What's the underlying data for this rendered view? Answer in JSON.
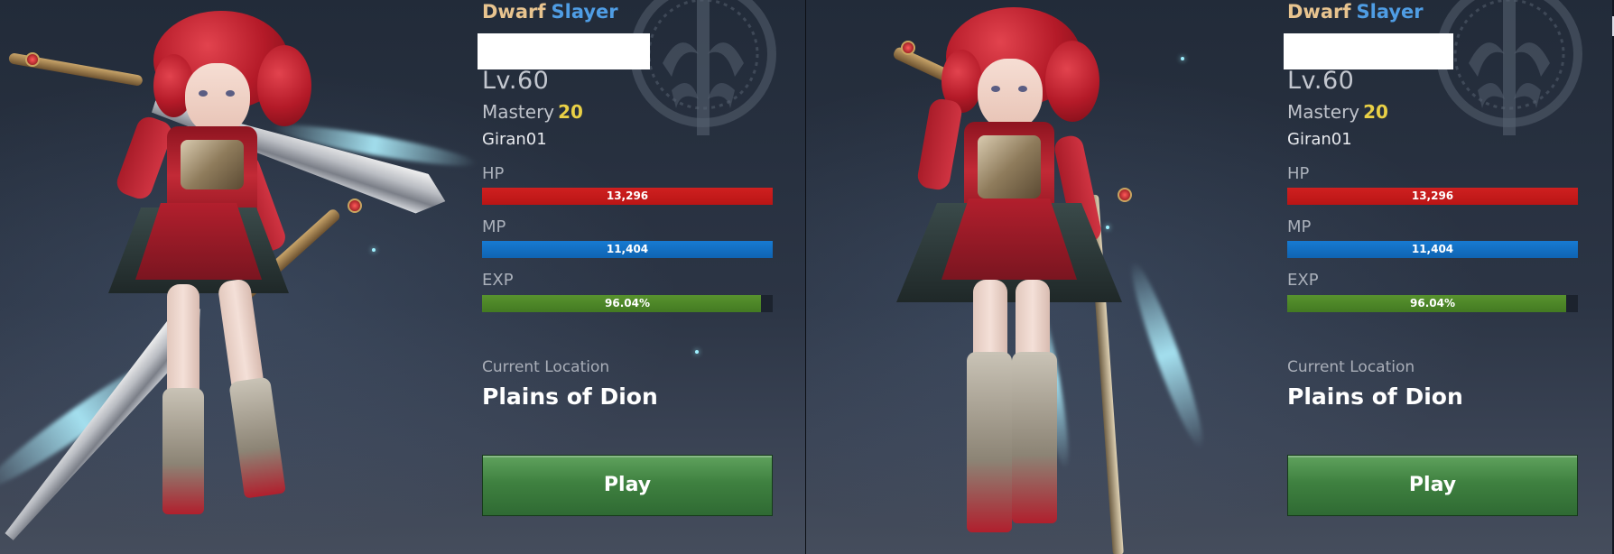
{
  "colors": {
    "race": "#e8c48f",
    "class": "#4f9de4",
    "mastery_value": "#e9d046",
    "hp": "#c41a1a",
    "mp": "#1270c4",
    "exp": "#4d8a28",
    "play_button": "#3f8140"
  },
  "panels": [
    {
      "race": "Dwarf",
      "class": "Slayer",
      "level": "Lv.60",
      "mastery_label": "Mastery",
      "mastery_value": "20",
      "server": "Giran01",
      "hp": {
        "label": "HP",
        "value": "13,296",
        "fill_fraction": 1.0
      },
      "mp": {
        "label": "MP",
        "value": "11,404",
        "fill_fraction": 1.0
      },
      "exp": {
        "label": "EXP",
        "value": "96.04%",
        "fill_fraction": 0.9604
      },
      "location_label": "Current Location",
      "location": "Plains of Dion",
      "play_label": "Play"
    },
    {
      "race": "Dwarf",
      "class": "Slayer",
      "level": "Lv.60",
      "mastery_label": "Mastery",
      "mastery_value": "20",
      "server": "Giran01",
      "hp": {
        "label": "HP",
        "value": "13,296",
        "fill_fraction": 1.0
      },
      "mp": {
        "label": "MP",
        "value": "11,404",
        "fill_fraction": 1.0
      },
      "exp": {
        "label": "EXP",
        "value": "96.04%",
        "fill_fraction": 0.9604
      },
      "location_label": "Current Location",
      "location": "Plains of Dion",
      "play_label": "Play"
    }
  ]
}
